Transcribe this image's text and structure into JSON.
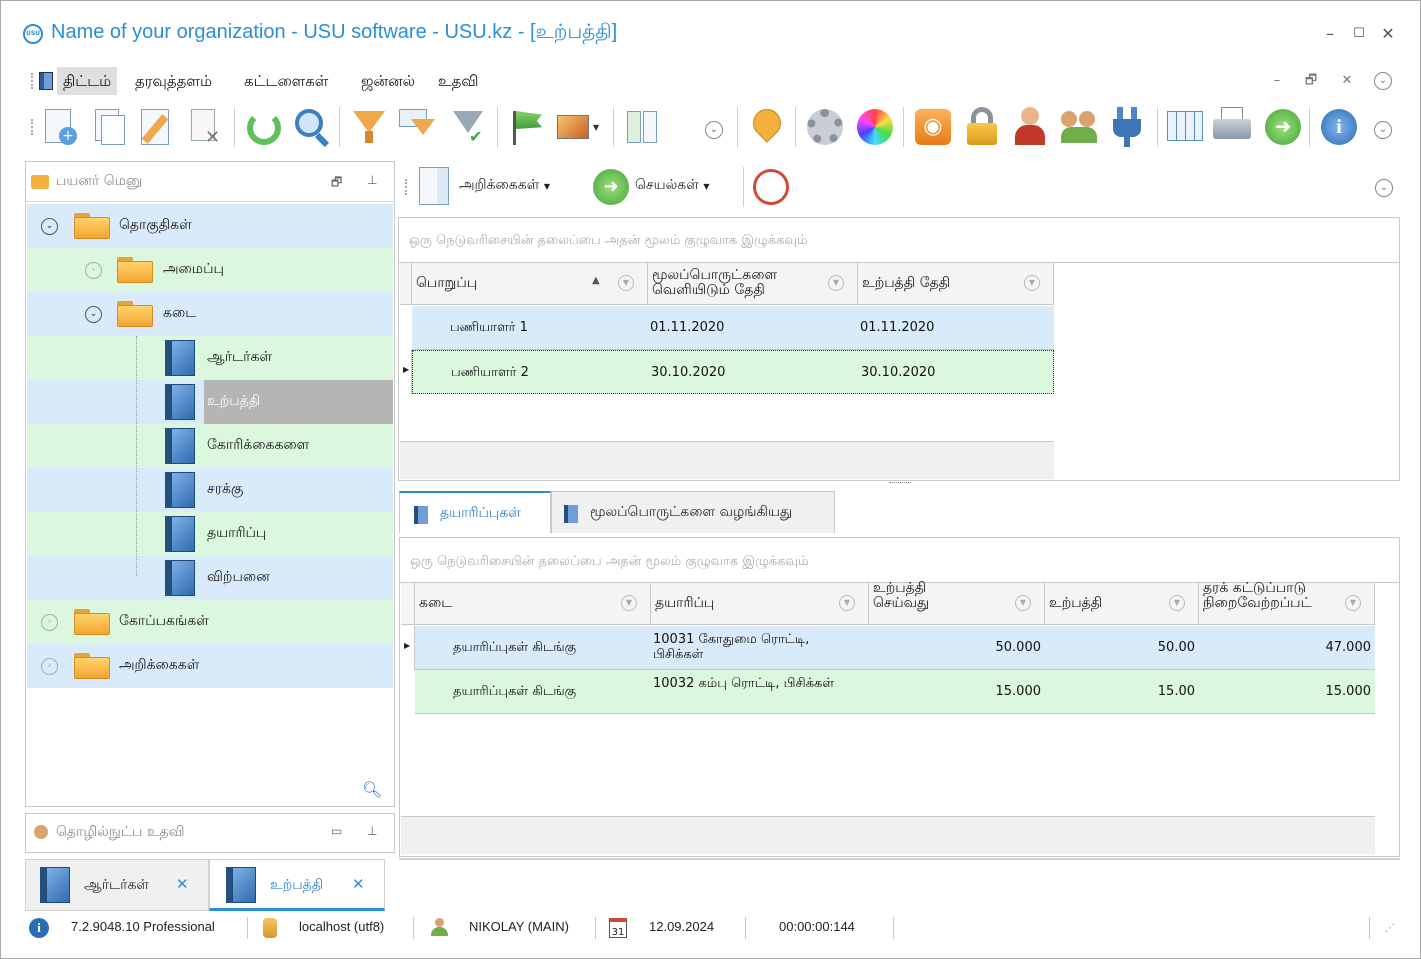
{
  "window": {
    "logo_text": "USU",
    "title": "Name of your organization - USU software - USU.kz - [உற்பத்தி]",
    "controls": [
      "–",
      "☐",
      "✕"
    ]
  },
  "menu": {
    "items": [
      "திட்டம்",
      "தரவுத்தளம்",
      "கட்டளைகள்",
      "ஜன்னல்",
      "உதவி"
    ],
    "mdi_controls": [
      "–",
      "🗗",
      "✕"
    ]
  },
  "left_pane": {
    "title": "பயனர் மெனு",
    "tree": [
      {
        "label": "தொகுதிகள்",
        "level": 0,
        "type": "folder",
        "expanded": true
      },
      {
        "label": "அமைப்பு",
        "level": 1,
        "type": "folder",
        "expanded": false
      },
      {
        "label": "கடை",
        "level": 1,
        "type": "folder",
        "expanded": true
      },
      {
        "label": "ஆர்டர்கள்",
        "level": 2,
        "type": "book"
      },
      {
        "label": "உற்பத்தி",
        "level": 2,
        "type": "book",
        "selected": true
      },
      {
        "label": "கோரிக்கைகளை",
        "level": 2,
        "type": "book"
      },
      {
        "label": "சரக்கு",
        "level": 2,
        "type": "book"
      },
      {
        "label": "தயாரிப்பு",
        "level": 2,
        "type": "book"
      },
      {
        "label": "விற்பனை",
        "level": 2,
        "type": "book"
      },
      {
        "label": "கோப்பகங்கள்",
        "level": 0,
        "type": "folder",
        "expanded": false
      },
      {
        "label": "அறிக்கைகள்",
        "level": 0,
        "type": "folder",
        "expanded": false
      }
    ]
  },
  "help_pane": {
    "title": "தொழில்நுட்ப உதவி"
  },
  "right_toolbar": {
    "reports_label": "அறிக்கைகள்",
    "actions_label": "செயல்கள்"
  },
  "top_grid": {
    "group_hint": "ஒரு நெடுவரிசையின் தலைப்பை அதன் மூலம் குழுவாக இழுக்கவும்",
    "columns": [
      "பொறுப்பு",
      "மூலப்பொருட்களை வெளியிடும் தேதி",
      "உற்பத்தி தேதி"
    ],
    "rows": [
      [
        "பணியாளர் 1",
        "01.11.2020",
        "01.11.2020"
      ],
      [
        "பணியாளர் 2",
        "30.10.2020",
        "30.10.2020"
      ]
    ]
  },
  "tabs": [
    "தயாரிப்புகள்",
    "மூலப்பொருட்களை வழங்கியது"
  ],
  "bottom_grid": {
    "group_hint": "ஒரு நெடுவரிசையின் தலைப்பை அதன் மூலம் குழுவாக இழுக்கவும்",
    "columns": [
      "கடை",
      "தயாரிப்பு",
      "உற்பத்தி செய்வது",
      "உற்பத்தி",
      "தரக் கட்டுப்பாடு நிறைவேற்றப்பட்"
    ],
    "rows": [
      [
        "தயாரிப்புகள் கிடங்கு",
        "10031 கோதுமை ரொட்டி, பிசிக்கள்",
        "50.000",
        "50.00",
        "47.000"
      ],
      [
        "தயாரிப்புகள் கிடங்கு",
        "10032 கம்பு ரொட்டி, பிசிக்கள்",
        "15.000",
        "15.00",
        "15.000"
      ]
    ]
  },
  "doc_tabs": [
    "ஆர்டர்கள்",
    "உற்பத்தி"
  ],
  "status": {
    "version": "7.2.9048.10 Professional",
    "db": "localhost (utf8)",
    "user": "NIKOLAY (MAIN)",
    "calendar_day": "31",
    "date": "12.09.2024",
    "timer": "00:00:00:144"
  }
}
